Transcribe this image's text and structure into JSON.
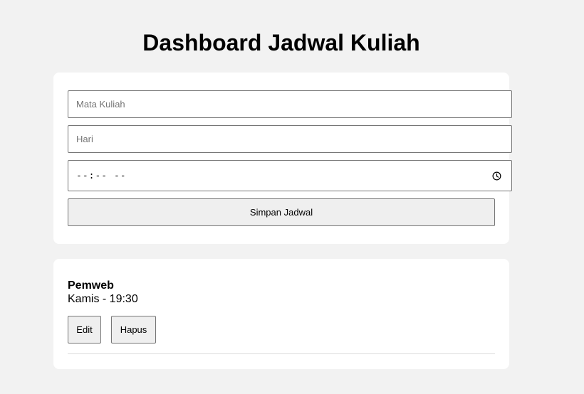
{
  "page": {
    "title": "Dashboard Jadwal Kuliah"
  },
  "form": {
    "mata_kuliah_placeholder": "Mata Kuliah",
    "hari_placeholder": "Hari",
    "time_display": "--:-- --",
    "save_label": "Simpan Jadwal"
  },
  "schedule": {
    "items": [
      {
        "title": "Pemweb",
        "detail": "Kamis - 19:30",
        "edit_label": "Edit",
        "delete_label": "Hapus"
      }
    ]
  },
  "icons": {
    "time": "clock-icon"
  }
}
